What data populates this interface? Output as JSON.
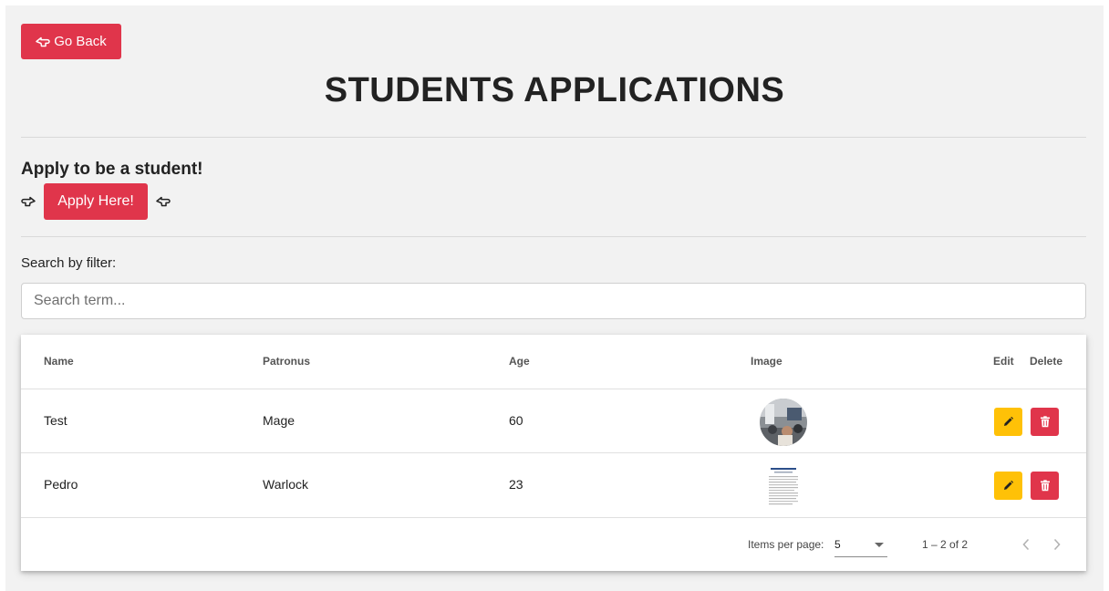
{
  "header": {
    "go_back_label": "Go Back",
    "title": "STUDENTS APPLICATIONS"
  },
  "apply": {
    "heading": "Apply to be a student!",
    "button_label": "Apply Here!"
  },
  "search": {
    "label": "Search by filter:",
    "placeholder": "Search term..."
  },
  "table": {
    "columns": {
      "name": "Name",
      "patronus": "Patronus",
      "age": "Age",
      "image": "Image",
      "edit": "Edit",
      "delete": "Delete"
    },
    "rows": [
      {
        "name": "Test",
        "patronus": "Mage",
        "age": "60",
        "image": "photo"
      },
      {
        "name": "Pedro",
        "patronus": "Warlock",
        "age": "23",
        "image": "document"
      }
    ]
  },
  "paginator": {
    "items_per_page_label": "Items per page:",
    "items_per_page_value": "5",
    "range_label": "1 – 2 of 2"
  },
  "icons": {
    "go_back": "hand-pointing-left-icon",
    "apply_left": "hand-pointing-right-icon",
    "apply_right": "hand-pointing-left-icon",
    "edit": "pencil-icon",
    "delete": "trash-icon",
    "prev": "chevron-left-icon",
    "next": "chevron-right-icon",
    "dropdown": "caret-down-icon"
  },
  "colors": {
    "primary_red": "#e0354b",
    "edit_yellow": "#ffc107",
    "page_bg": "#f2f2f2"
  }
}
